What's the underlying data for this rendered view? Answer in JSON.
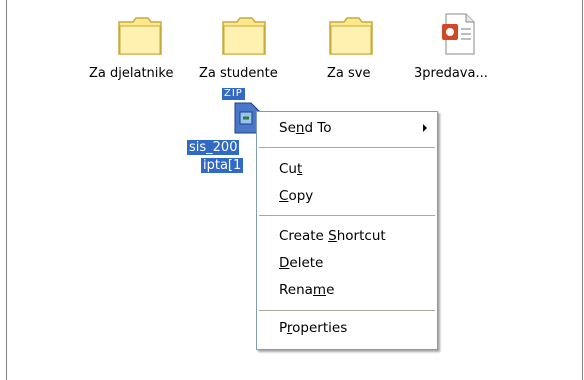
{
  "desktop": {
    "items": [
      {
        "label": "Za djelatnike",
        "icon": "folder-icon"
      },
      {
        "label": "Za studente",
        "icon": "folder-icon"
      },
      {
        "label": "Za sve",
        "icon": "folder-icon"
      },
      {
        "label": "3predava...",
        "icon": "powerpoint-file-icon"
      }
    ],
    "selected": {
      "icon": "zip-file-icon",
      "zip_badge": "ZIP",
      "line1": "sis_200",
      "line2": "ipta[1"
    }
  },
  "context_menu": {
    "items": [
      {
        "pre": "Se",
        "u": "n",
        "post": "d To",
        "submenu": true
      },
      {
        "pre": "Cu",
        "u": "t",
        "post": ""
      },
      {
        "pre": "",
        "u": "C",
        "post": "opy"
      },
      {
        "pre": "Create ",
        "u": "S",
        "post": "hortcut"
      },
      {
        "pre": "",
        "u": "D",
        "post": "elete"
      },
      {
        "pre": "Rena",
        "u": "m",
        "post": "e"
      },
      {
        "pre": "P",
        "u": "r",
        "post": "operties"
      }
    ]
  },
  "colors": {
    "selection": "#316ac5",
    "folder": "#ffe88c",
    "menu_border": "#7f9db9"
  }
}
